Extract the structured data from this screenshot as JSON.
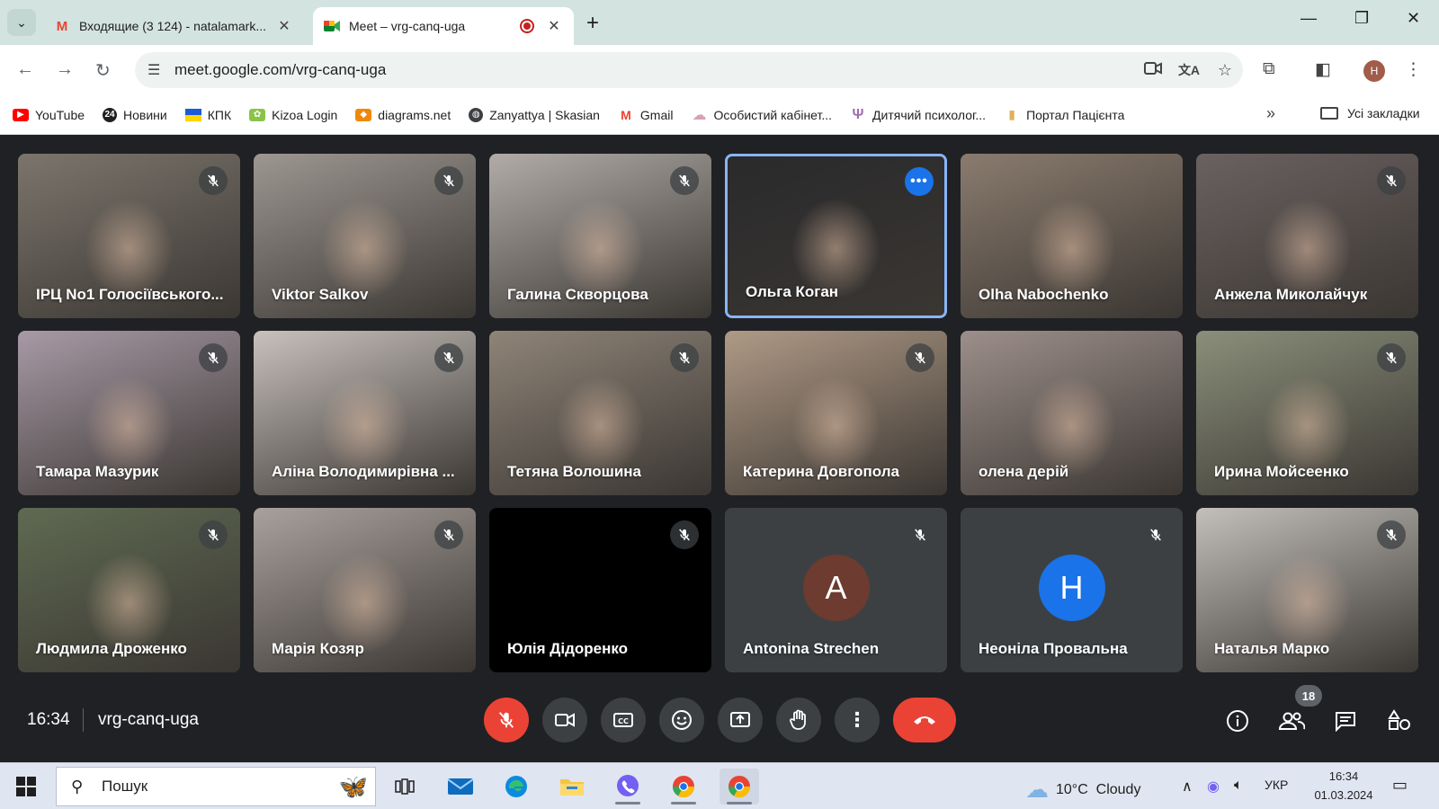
{
  "browser": {
    "tabs": [
      {
        "title": "Входящие (3 124) - natalamark...",
        "active": false
      },
      {
        "title": "Meet – vrg-canq-uga",
        "active": true
      }
    ],
    "url": "meet.google.com/vrg-canq-uga",
    "profile_initial": "H",
    "bookmarks": [
      {
        "label": "YouTube",
        "icon": "youtube-icon",
        "color": "#ff0000"
      },
      {
        "label": "Новини",
        "icon": "news-24-icon",
        "color": "#1f1f1f"
      },
      {
        "label": "КПК",
        "icon": "ukraine-flag-icon",
        "color": "#1c5bd8"
      },
      {
        "label": "Kizoa Login",
        "icon": "kizoa-icon",
        "color": "#8bc34a"
      },
      {
        "label": "diagrams.net",
        "icon": "drawio-icon",
        "color": "#f08705"
      },
      {
        "label": "Zanyattya | Skasian",
        "icon": "globe-icon",
        "color": "#3c4043"
      },
      {
        "label": "Gmail",
        "icon": "gmail-icon",
        "color": "#ea4335"
      },
      {
        "label": "Особистий кабінет...",
        "icon": "cloud-icon",
        "color": "#d8a0b8"
      },
      {
        "label": "Дитячий психолог...",
        "icon": "psy-icon",
        "color": "#9c6fb0"
      },
      {
        "label": "Портал Пацієнта",
        "icon": "doc-icon",
        "color": "#e0b060"
      }
    ],
    "all_bookmarks": "Усі закладки"
  },
  "meet": {
    "participants": [
      {
        "name": "ІРЦ No1 Голосіївського...",
        "bg": "#7b756c",
        "photo": true,
        "muted": true
      },
      {
        "name": "Viktor Salkov",
        "bg": "#9d9791",
        "photo": true,
        "muted": true
      },
      {
        "name": "Галина Скворцова",
        "bg": "#b1aca8",
        "photo": true,
        "muted": true
      },
      {
        "name": "Ольга Коган",
        "bg": "#2a2a2c",
        "photo": true,
        "muted": false,
        "speaking": true
      },
      {
        "name": "Olha Nabochenko",
        "bg": "#8a7b6e",
        "photo": true,
        "muted": false
      },
      {
        "name": "Анжела Миколайчук",
        "bg": "#6a6160",
        "photo": true,
        "muted": true
      },
      {
        "name": "Тамара Мазурик",
        "bg": "#a89aa6",
        "photo": true,
        "muted": true
      },
      {
        "name": "Аліна Володимирівна ...",
        "bg": "#c8c1bc",
        "photo": true,
        "muted": true
      },
      {
        "name": "Тетяна Волошина",
        "bg": "#8f8478",
        "photo": true,
        "muted": true
      },
      {
        "name": "Катерина Довгопола",
        "bg": "#b09a86",
        "photo": true,
        "muted": true
      },
      {
        "name": "олена дерій",
        "bg": "#9d8f8a",
        "photo": true,
        "muted": false
      },
      {
        "name": "Ирина Мойсеенко",
        "bg": "#8a8f7a",
        "photo": true,
        "muted": true
      },
      {
        "name": "Людмила Дроженко",
        "bg": "#5f6a52",
        "photo": true,
        "muted": true
      },
      {
        "name": "Марія Козяр",
        "bg": "#a9a19c",
        "photo": true,
        "muted": true
      },
      {
        "name": "Юлія Дідоренко",
        "bg": "#000000",
        "photo": false,
        "muted": true
      },
      {
        "name": "Antonina Strechen",
        "bg": "#3c4043",
        "photo": false,
        "muted": true,
        "avatar_letter": "A",
        "avatar_color": "#6d3b2f"
      },
      {
        "name": "Неоніла Провальна",
        "bg": "#3c4043",
        "photo": false,
        "muted": true,
        "avatar_letter": "H",
        "avatar_color": "#1a73e8"
      },
      {
        "name": "Наталья Марко",
        "bg": "#c3bfbb",
        "photo": true,
        "muted": true
      }
    ],
    "time": "16:34",
    "meeting_code": "vrg-canq-uga",
    "participant_count": "18"
  },
  "taskbar": {
    "search_placeholder": "Пошук",
    "weather": "10°C  Cloudy",
    "language": "УКР",
    "time": "16:34",
    "date": "01.03.2024"
  },
  "colors": {
    "meet_bg": "#202124",
    "tile_bg": "#3c4043",
    "danger": "#ea4335",
    "accent": "#1a73e8"
  }
}
